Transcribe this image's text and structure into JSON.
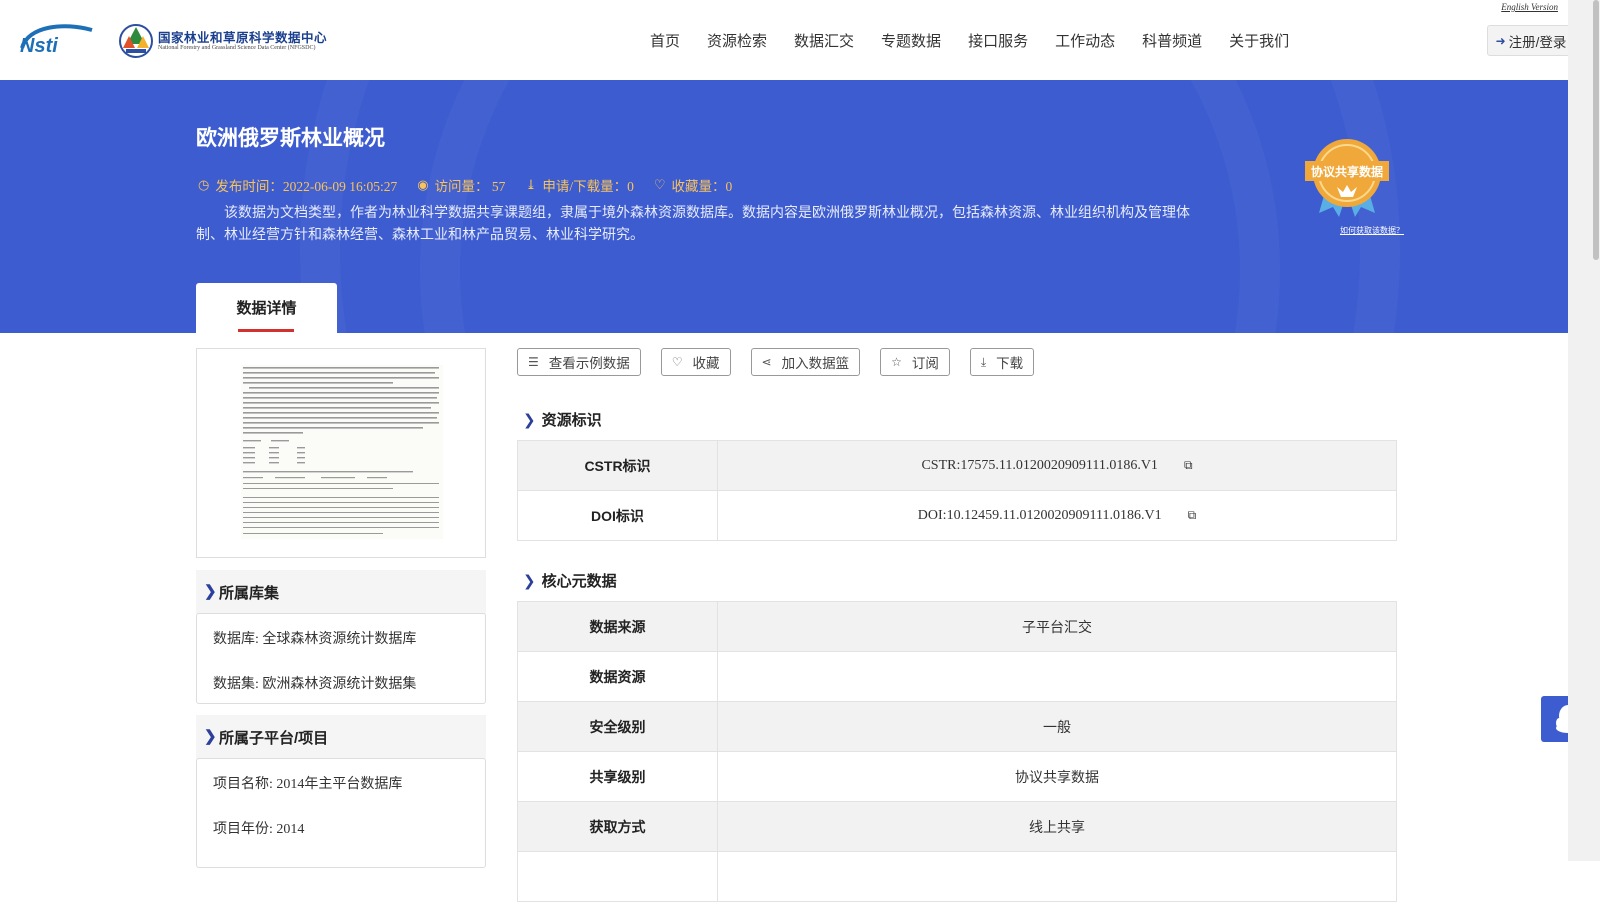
{
  "header": {
    "logo_text": "Nsti",
    "center_name_cn": "国家林业和草原科学数据中心",
    "center_name_en": "National Forestry and Grassland Science Data Center (NFGSDC)",
    "english_version": "English Version",
    "nav": [
      "首页",
      "资源检索",
      "数据汇交",
      "专题数据",
      "接口服务",
      "工作动态",
      "科普频道",
      "关于我们"
    ],
    "login_label": "注册/登录"
  },
  "banner": {
    "title": "欧洲俄罗斯林业概况",
    "publish_time": "发布时间：2022-06-09 16:05:27",
    "visits": "访问量： 57",
    "downloads": "申请/下载量：0",
    "favorites": "收藏量：0",
    "description": "该数据为文档类型，作者为林业科学数据共享课题组，隶属于境外森林资源数据库。数据内容是欧洲俄罗斯林业概况，包括森林资源、林业组织机构及管理体制、林业经营方针和森林经营、森林工业和林产品贸易、林业科学研究。",
    "badge_text": "协议共享数据",
    "badge_link": "如何获取该数据？",
    "tab_label": "数据详情"
  },
  "sidebar": {
    "collection": {
      "title": "所属库集",
      "database": "数据库: 全球森林资源统计数据库",
      "dataset": "数据集: 欧洲森林资源统计数据集"
    },
    "project": {
      "title": "所属子平台/项目",
      "name": "项目名称: 2014年主平台数据库",
      "year": "项目年份: 2014"
    }
  },
  "actions": [
    "查看示例数据",
    "收藏",
    "加入数据篮",
    "订阅",
    "下载"
  ],
  "resource_id": {
    "title": "资源标识",
    "rows": [
      {
        "key": "CSTR标识",
        "value": "CSTR:17575.11.0120020909111.0186.V1"
      },
      {
        "key": "DOI标识",
        "value": "DOI:10.12459.11.0120020909111.0186.V1"
      }
    ]
  },
  "core_meta": {
    "title": "核心元数据",
    "rows": [
      {
        "key": "数据来源",
        "value": "子平台汇交"
      },
      {
        "key": "数据资源",
        "value": ""
      },
      {
        "key": "安全级别",
        "value": "一般"
      },
      {
        "key": "共享级别",
        "value": "协议共享数据"
      },
      {
        "key": "获取方式",
        "value": "线上共享"
      }
    ]
  },
  "colors": {
    "banner_bg": "#3d5ccf",
    "meta_text": "#f8c35a",
    "accent_red": "#d2322d",
    "chevron": "#2c3f9a"
  },
  "icons": {
    "publish": "clock-icon",
    "visits": "eye-icon",
    "downloads": "download-icon",
    "favorites": "heart-icon",
    "float": "qq-penguin-icon"
  }
}
